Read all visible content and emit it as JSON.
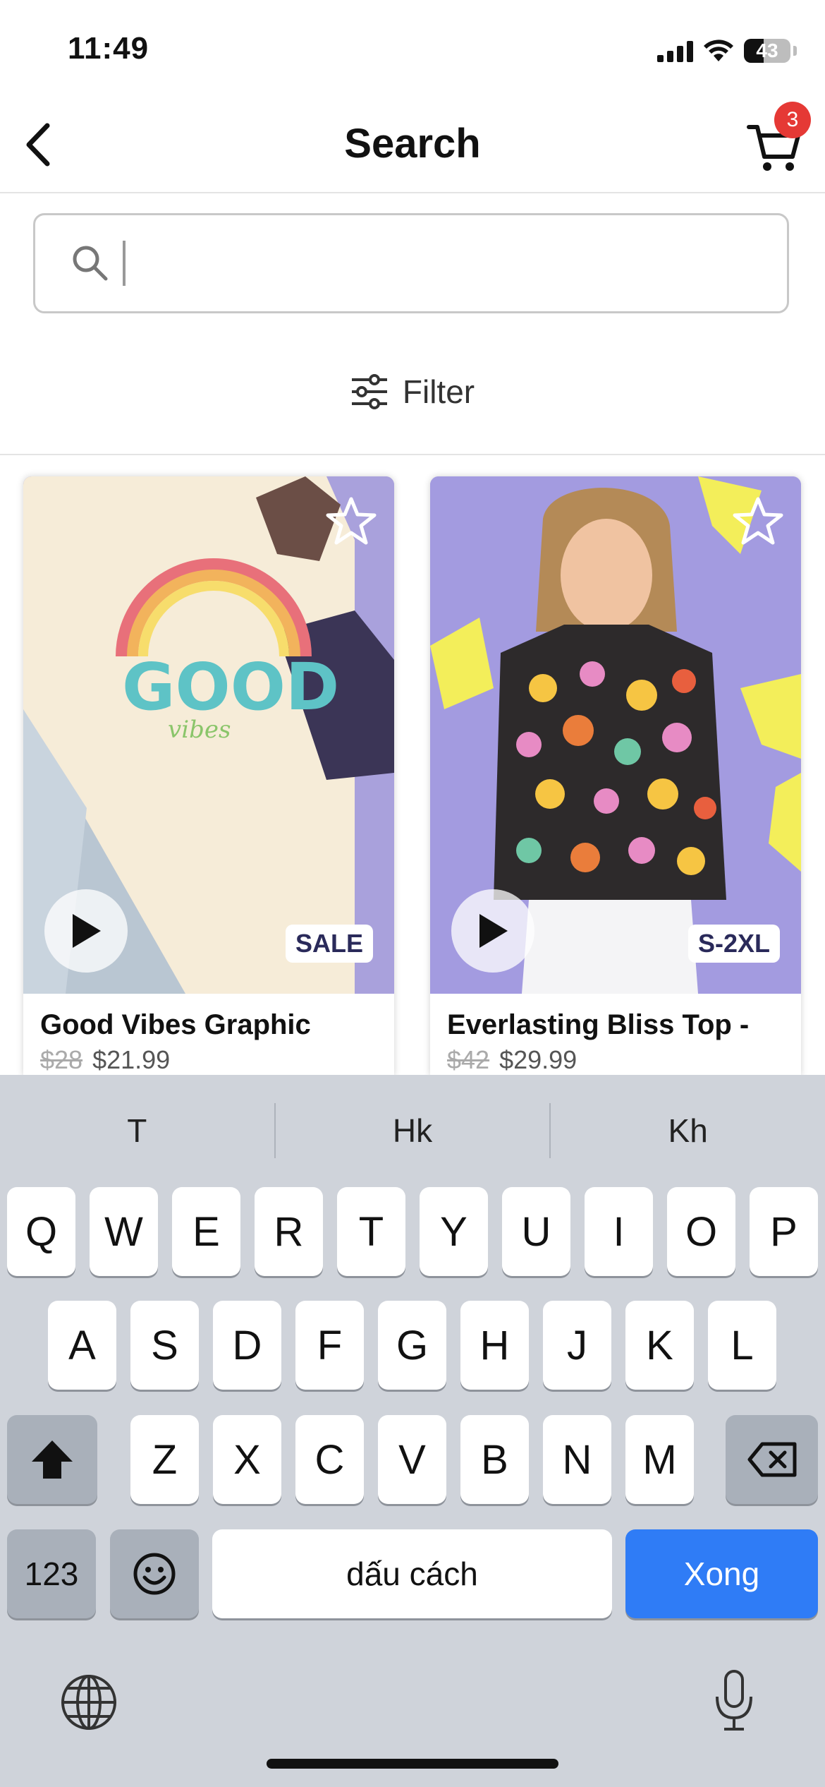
{
  "status_bar": {
    "time": "11:49",
    "battery": "43"
  },
  "header": {
    "title": "Search",
    "cart_count": "3"
  },
  "search": {
    "placeholder": "",
    "value": ""
  },
  "filter": {
    "label": "Filter"
  },
  "products": [
    {
      "title": "Good Vibes Graphic",
      "old_price": "$28",
      "price": "$21.99",
      "badge": "SALE"
    },
    {
      "title": "Everlasting Bliss Top -",
      "old_price": "$42",
      "price": "$29.99",
      "badge": "S-2XL"
    }
  ],
  "keyboard": {
    "suggestions": [
      "T",
      "Hk",
      "Kh"
    ],
    "row1": [
      "Q",
      "W",
      "E",
      "R",
      "T",
      "Y",
      "U",
      "I",
      "O",
      "P"
    ],
    "row2": [
      "A",
      "S",
      "D",
      "F",
      "G",
      "H",
      "J",
      "K",
      "L"
    ],
    "row3": [
      "Z",
      "X",
      "C",
      "V",
      "B",
      "N",
      "M"
    ],
    "numbers_label": "123",
    "space_label": "dấu cách",
    "return_label": "Xong"
  },
  "colors": {
    "accent": "#2f7cf6",
    "badge": "#e53935",
    "product_bg": "#a59fd6"
  }
}
